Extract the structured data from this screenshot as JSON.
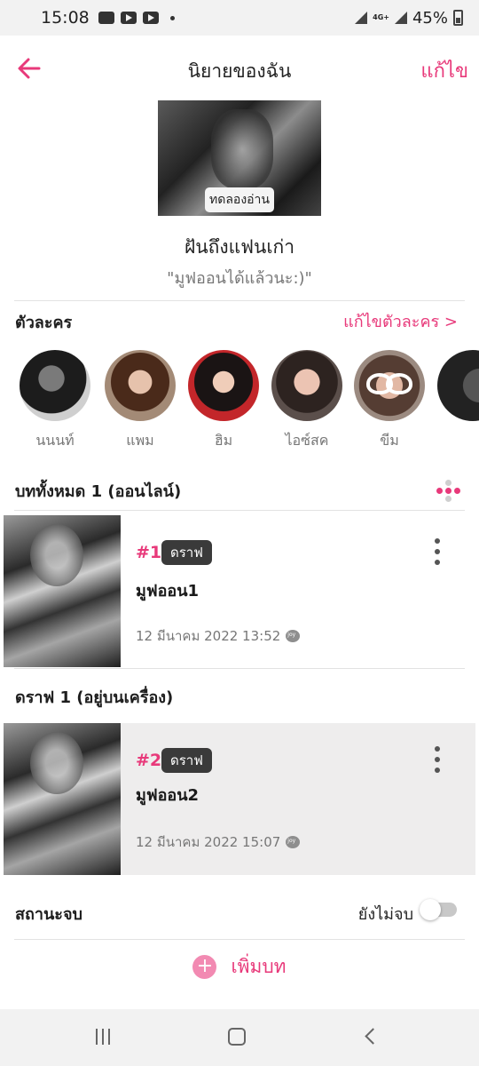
{
  "status_bar": {
    "time": "15:08",
    "network": "4G+",
    "battery": "45%"
  },
  "header": {
    "title": "นิยายของฉัน",
    "edit_label": "แก้ไข"
  },
  "story": {
    "preview_label": "ทดลองอ่าน",
    "title": "ฝันถึงแฟนเก่า",
    "subtitle": "\"มูฟออนได้แล้วนะ:)\""
  },
  "characters": {
    "heading": "ตัวละคร",
    "edit_link": "แก้ไขตัวละคร >",
    "items": [
      {
        "name": "นนนท์"
      },
      {
        "name": "แพม"
      },
      {
        "name": "ฮิม"
      },
      {
        "name": "ไอซ์สค"
      },
      {
        "name": "ขีม"
      }
    ]
  },
  "online_chapters": {
    "heading": "บททั้งหมด 1 (ออนไลน์)",
    "items": [
      {
        "number": "#1",
        "status": "ดราฟ",
        "title": "มูฟออน1",
        "date": "12 มีนาคม 2022 13:52"
      }
    ]
  },
  "draft_chapters": {
    "heading": "ดราฟ 1 (อยู่บนเครื่อง)",
    "items": [
      {
        "number": "#2",
        "status": "ดราฟ",
        "title": "มูฟออน2",
        "date": "12 มีนาคม 2022 15:07"
      }
    ]
  },
  "completion": {
    "label": "สถานะจบ",
    "value": "ยังไม่จบ",
    "is_complete": false
  },
  "add_chapter": {
    "label": "เพิ่มบท"
  },
  "colors": {
    "accent": "#e8397a",
    "badge": "#3a3a3a",
    "draft_row_bg": "#eeeded"
  }
}
